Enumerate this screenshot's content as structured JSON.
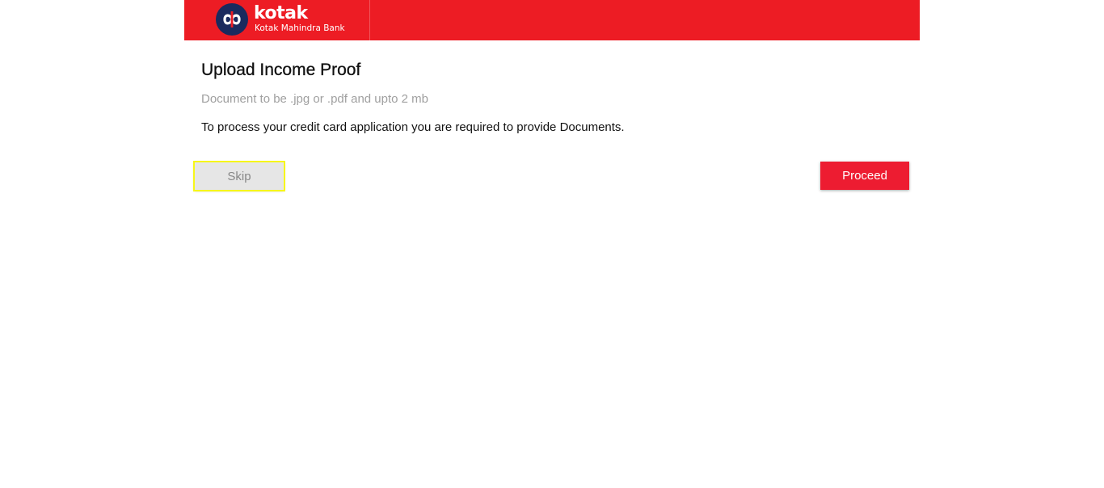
{
  "header": {
    "brand": "kotak",
    "bank_name": "Kotak Mahindra Bank",
    "logo_icon": "kotak-infinity-logo",
    "color": "#ed1c24"
  },
  "main": {
    "title": "Upload Income Proof",
    "file_note": "Document to be .jpg or .pdf and upto 2 mb",
    "description": "To process your credit card application you are required to provide Documents."
  },
  "actions": {
    "skip_label": "Skip",
    "proceed_label": "Proceed",
    "proceed_color": "#ed1c31",
    "skip_highlight_color": "#f7f71a"
  }
}
